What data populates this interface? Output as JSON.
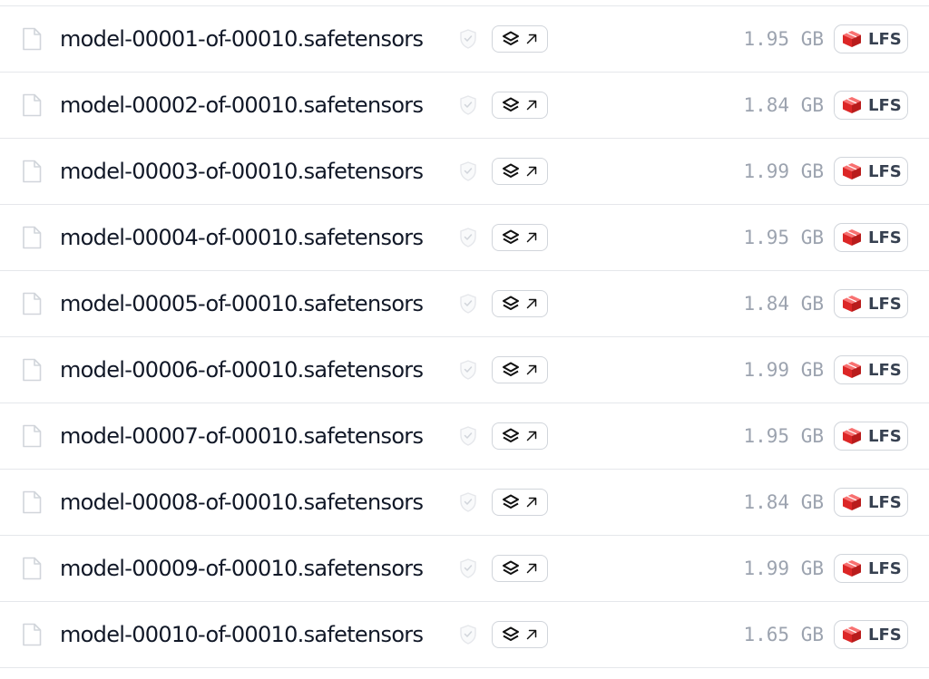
{
  "files": [
    {
      "name": "model-00001-of-00010.safetensors",
      "size": "1.95 GB",
      "badge": "LFS"
    },
    {
      "name": "model-00002-of-00010.safetensors",
      "size": "1.84 GB",
      "badge": "LFS"
    },
    {
      "name": "model-00003-of-00010.safetensors",
      "size": "1.99 GB",
      "badge": "LFS"
    },
    {
      "name": "model-00004-of-00010.safetensors",
      "size": "1.95 GB",
      "badge": "LFS"
    },
    {
      "name": "model-00005-of-00010.safetensors",
      "size": "1.84 GB",
      "badge": "LFS"
    },
    {
      "name": "model-00006-of-00010.safetensors",
      "size": "1.99 GB",
      "badge": "LFS"
    },
    {
      "name": "model-00007-of-00010.safetensors",
      "size": "1.95 GB",
      "badge": "LFS"
    },
    {
      "name": "model-00008-of-00010.safetensors",
      "size": "1.84 GB",
      "badge": "LFS"
    },
    {
      "name": "model-00009-of-00010.safetensors",
      "size": "1.99 GB",
      "badge": "LFS"
    },
    {
      "name": "model-00010-of-00010.safetensors",
      "size": "1.65 GB",
      "badge": "LFS"
    }
  ],
  "icons": {
    "file": "file-icon",
    "safety": "shield-check-icon",
    "viewer": "layers-icon",
    "external": "arrow-up-right-icon",
    "lfs": "lfs-cube-icon"
  },
  "colors": {
    "lfs_accent": "#e04f3f",
    "size_text": "#9ca3af",
    "divider": "#e5e7eb"
  }
}
